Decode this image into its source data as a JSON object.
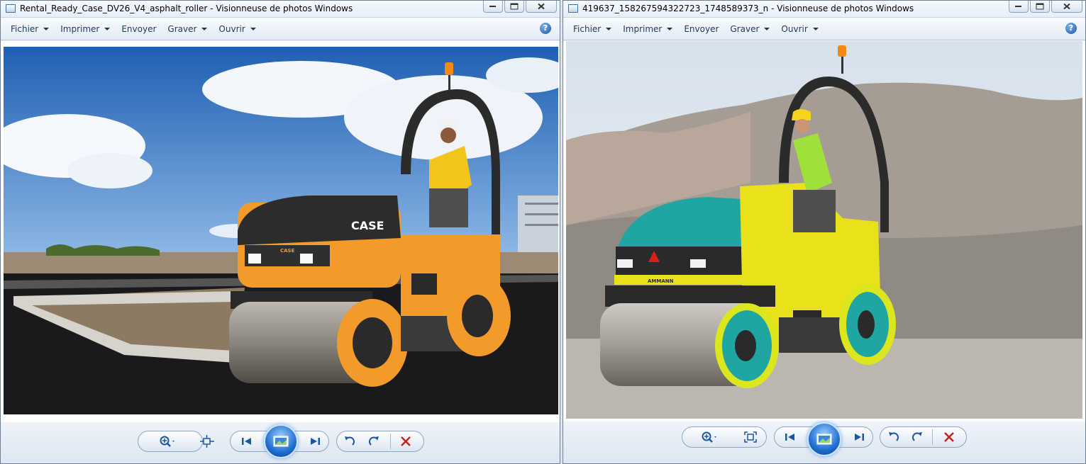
{
  "windows": [
    {
      "title": "Rental_Ready_Case_DV26_V4_asphalt_roller - Visionneuse de photos Windows",
      "menu": [
        "Fichier",
        "Imprimer",
        "Envoyer",
        "Graver",
        "Ouvrir"
      ],
      "help": "?",
      "photo": {
        "brand_label": "CASE",
        "hood_label": "CASE"
      }
    },
    {
      "title": "419637_158267594322723_1748589373_n - Visionneuse de photos Windows",
      "menu": [
        "Fichier",
        "Imprimer",
        "Envoyer",
        "Graver",
        "Ouvrir"
      ],
      "help": "?",
      "photo": {
        "brand_label": "AMMANN"
      }
    }
  ],
  "colors": {
    "menu_text": "#1e395b",
    "close_x": "#c4231c",
    "nav_blue": "#1c56a6"
  }
}
